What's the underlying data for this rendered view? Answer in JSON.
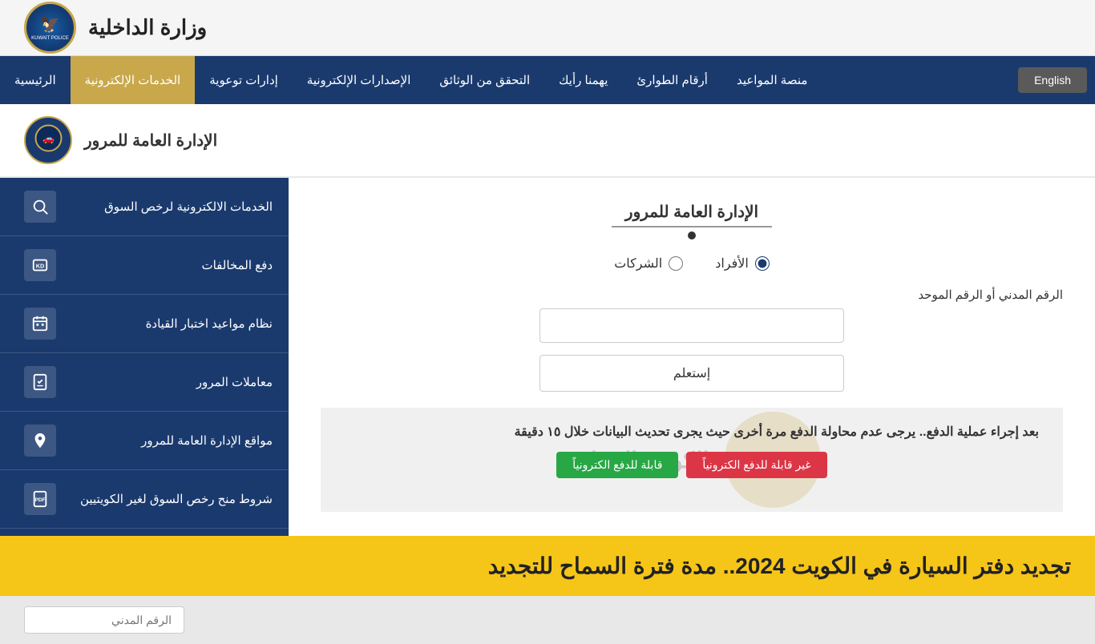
{
  "header": {
    "title": "وزارة الداخلية",
    "logo_alt": "Kuwait Police Logo"
  },
  "navbar": {
    "items": [
      {
        "id": "home",
        "label": "الرئيسية"
      },
      {
        "id": "eservices",
        "label": "الخدمات الإلكترونية"
      },
      {
        "id": "awareness",
        "label": "إدارات توعوية"
      },
      {
        "id": "epublications",
        "label": "الإصدارات الإلكترونية"
      },
      {
        "id": "verify",
        "label": "التحقق من الوثائق"
      },
      {
        "id": "opinion",
        "label": "يهمنا رأيك"
      },
      {
        "id": "emergency",
        "label": "أرقام الطوارئ"
      },
      {
        "id": "appointments",
        "label": "منصة المواعيد"
      }
    ],
    "english_label": "English"
  },
  "sub_header": {
    "title": "الإدارة العامة للمرور"
  },
  "form": {
    "title": "الإدارة العامة للمرور",
    "radio_individuals": "الأفراد",
    "radio_companies": "الشركات",
    "field_label": "الرقم المدني أو الرقم الموحد",
    "field_placeholder": "",
    "submit_label": "إستعلم"
  },
  "notice": {
    "text": "بعد إجراء عملية الدفع.. يرجى عدم محاولة الدفع مرة أخرى حيث يجرى تحديث البيانات خلال ١٥ دقيقة",
    "btn_eligible": "قابلة للدفع الكترونياً",
    "btn_not_eligible": "غير قابلة للدفع الكترونياً"
  },
  "sidebar": {
    "items": [
      {
        "id": "eservices-license",
        "label": "الخدمات الالكترونية لرخص السوق",
        "icon": "search"
      },
      {
        "id": "pay-fines",
        "label": "دفع المخالفات",
        "icon": "kd"
      },
      {
        "id": "driving-test",
        "label": "نظام مواعيد اختبار القيادة",
        "icon": "calendar"
      },
      {
        "id": "transactions",
        "label": "معاملات المرور",
        "icon": "doc-check"
      },
      {
        "id": "locations",
        "label": "مواقع الإدارة العامة للمرور",
        "icon": "location"
      },
      {
        "id": "conditions",
        "label": "شروط منح رخص السوق لغير الكويتيين",
        "icon": "pdf"
      }
    ]
  },
  "bottom_banner": {
    "text": "تجديد دفتر السيارة في الكويت 2024.. مدة فترة السماح للتجديد"
  },
  "footer": {
    "input_placeholder": "الرقم المدني"
  }
}
